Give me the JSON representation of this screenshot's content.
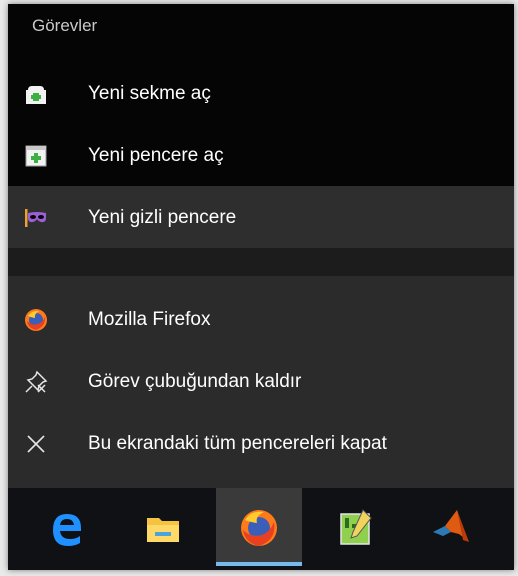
{
  "jump_list": {
    "tasks_header": "Görevler",
    "tasks": [
      {
        "label": "Yeni sekme aç",
        "icon": "new-tab-icon"
      },
      {
        "label": "Yeni pencere aç",
        "icon": "new-window-icon"
      },
      {
        "label": "Yeni gizli pencere",
        "icon": "private-mask-icon"
      }
    ],
    "actions": [
      {
        "label": "Mozilla Firefox",
        "icon": "firefox-icon"
      },
      {
        "label": "Görev çubuğundan kaldır",
        "icon": "unpin-icon"
      },
      {
        "label": "Bu ekrandaki tüm pencereleri kapat",
        "icon": "close-icon"
      }
    ]
  },
  "taskbar": {
    "apps": [
      {
        "icon": "edge-icon"
      },
      {
        "icon": "file-explorer-icon"
      },
      {
        "icon": "firefox-icon",
        "active": true
      },
      {
        "icon": "notepad-plus-plus-icon"
      },
      {
        "icon": "matlab-icon"
      }
    ]
  },
  "colors": {
    "menu_bg": "#050505",
    "menu_bottom_bg": "#2b2b2b",
    "hover_bg": "#2e2e2e",
    "accent": "#76b9ed",
    "private_purple": "#9b5fd6"
  }
}
